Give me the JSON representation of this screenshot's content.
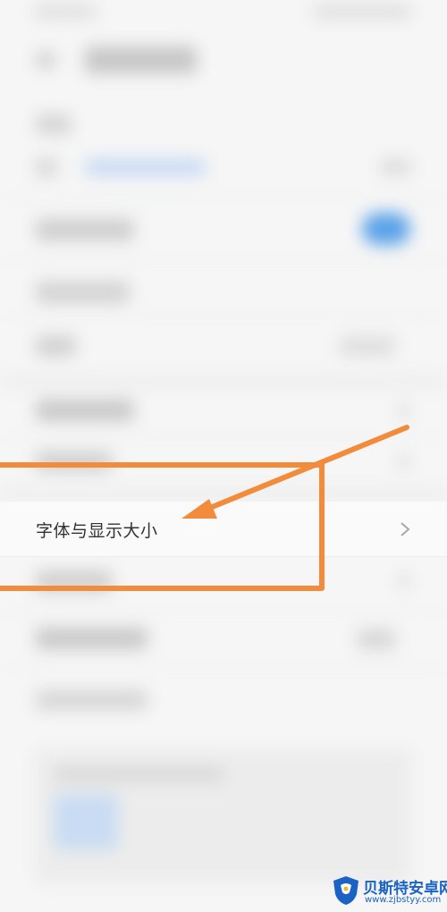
{
  "settings": {
    "highlighted_item_label": "字体与显示大小"
  },
  "watermark": {
    "name": "贝斯特安卓网",
    "url": "www.zjbstyy.com"
  },
  "colors": {
    "annotation": "#f28c3c",
    "watermark": "#1a63c4",
    "toggle_on": "#5aa2e8"
  },
  "icons": {
    "back": "back-arrow-icon",
    "chevron": "chevron-right-icon",
    "logo": "shield-logo-icon"
  }
}
